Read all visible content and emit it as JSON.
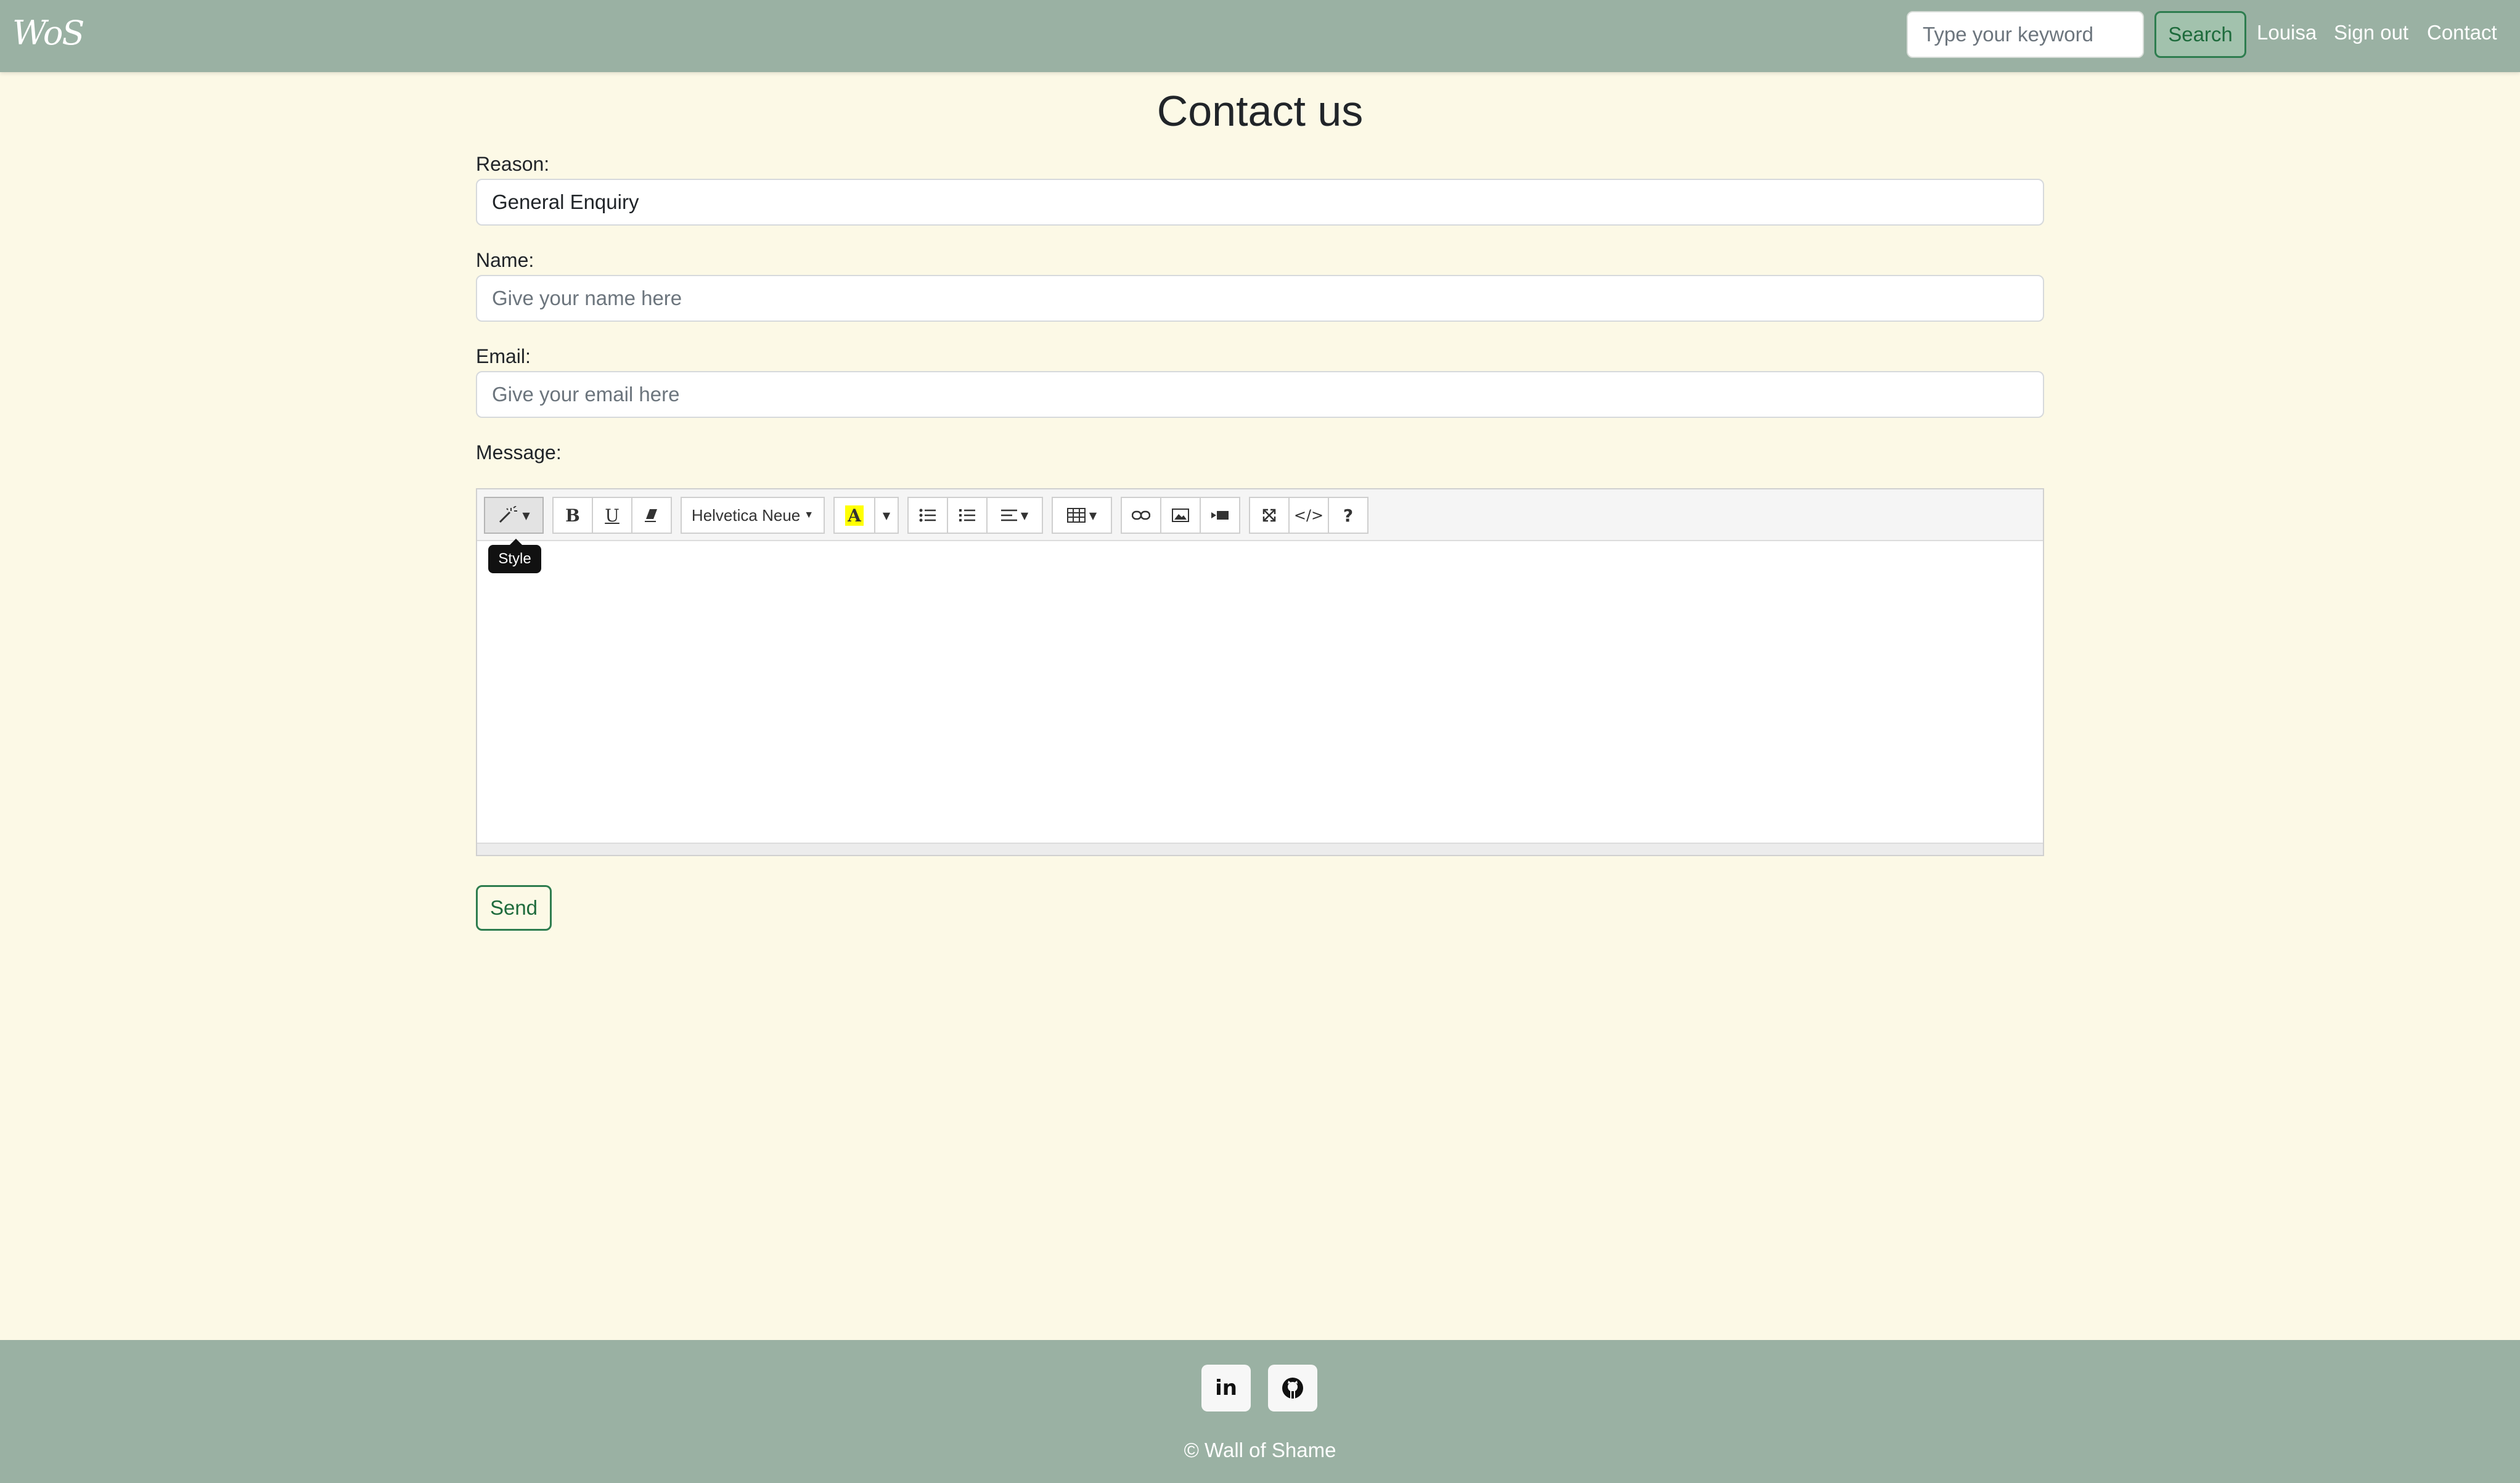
{
  "navbar": {
    "logo_text": "WoS",
    "search_placeholder": "Type your keyword",
    "search_label": "Search",
    "user_link": "Louisa",
    "signout_link": "Sign out",
    "contact_link": "Contact"
  },
  "page": {
    "title": "Contact us"
  },
  "form": {
    "reason_label": "Reason:",
    "reason_value": "General Enquiry",
    "name_label": "Name:",
    "name_placeholder": "Give your name here",
    "email_label": "Email:",
    "email_placeholder": "Give your email here",
    "message_label": "Message:",
    "send_label": "Send"
  },
  "editor": {
    "font_name": "Helvetica Neue",
    "tooltip": "Style",
    "bold_glyph": "B",
    "underline_glyph": "U",
    "highlight_glyph": "A",
    "highlight_color": "#ffff00",
    "code_glyph": "</>",
    "help_glyph": "?"
  },
  "footer": {
    "linkedin_glyph": "in",
    "copyright": "© Wall of Shame"
  },
  "colors": {
    "navbar": "#9ab1a3",
    "background": "#fcf9e6",
    "accent": "#2e7d4f"
  }
}
